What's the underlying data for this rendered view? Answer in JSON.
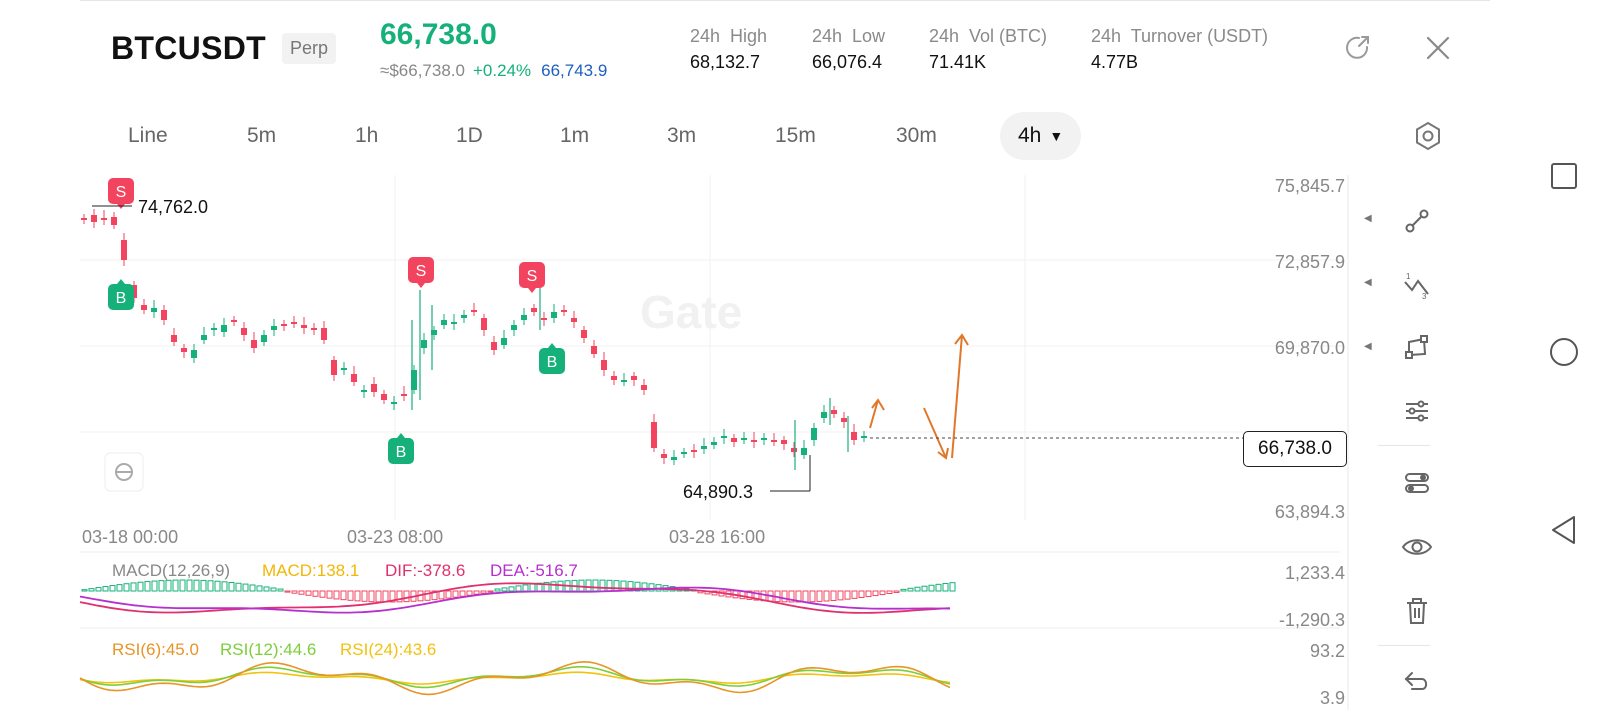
{
  "header": {
    "symbol": "BTCUSDT",
    "contract_type": "Perp",
    "last_price": "66,738.0",
    "usd_value": "≈$66,738.0",
    "change_pct": "+0.24%",
    "mark_price": "66,743.9",
    "stats": [
      {
        "label": "24h  High",
        "value": "68,132.7"
      },
      {
        "label": "24h  Low",
        "value": "66,076.4"
      },
      {
        "label": "24h  Vol (BTC)",
        "value": "71.41K"
      },
      {
        "label": "24h  Turnover (USDT)",
        "value": "4.77B"
      }
    ],
    "icons": {
      "share": "share-icon",
      "close": "close-icon"
    }
  },
  "timeframes": {
    "items": [
      "Line",
      "5m",
      "1h",
      "1D",
      "1m",
      "3m",
      "15m",
      "30m"
    ],
    "active": "4h"
  },
  "chart": {
    "watermark": "Gate",
    "y_axis_labels": [
      "75,845.7",
      "72,857.9",
      "69,870.0",
      "63,894.3"
    ],
    "current_price": "66,738.0",
    "high_marker": "74,762.0",
    "low_marker": "64,890.3",
    "x_axis_labels": [
      "03-18 00:00",
      "03-23 08:00",
      "03-28 16:00"
    ],
    "signal_markers": [
      "S",
      "B",
      "S",
      "B",
      "S",
      "B"
    ],
    "macd": {
      "label": "MACD(12,26,9)",
      "macd": "MACD:138.1",
      "dif": "DIF:-378.6",
      "dea": "DEA:-516.7",
      "axis": [
        "1,233.4",
        "-1,290.3"
      ]
    },
    "rsi": {
      "rsi6": "RSI(6):45.0",
      "rsi12": "RSI(12):44.6",
      "rsi24": "RSI(24):43.6",
      "axis": [
        "93.2",
        "3.9"
      ]
    }
  },
  "colors": {
    "up": "#16b07a",
    "down": "#f2445f",
    "macd": "#f2b705",
    "dif": "#e0306e",
    "dea": "#b62fcf",
    "rsi6": "#e89426",
    "rsi12": "#7ccf3a",
    "rsi24": "#f2c20f",
    "annotation": "#e0782c"
  },
  "toolbar": [
    "trend-line-icon",
    "fibonacci-icon",
    "shape-icon",
    "indicator-settings-icon",
    "layout-icon",
    "visibility-icon",
    "delete-icon",
    "undo-icon"
  ],
  "android_nav": [
    "recent-apps-icon",
    "home-icon",
    "back-icon"
  ]
}
